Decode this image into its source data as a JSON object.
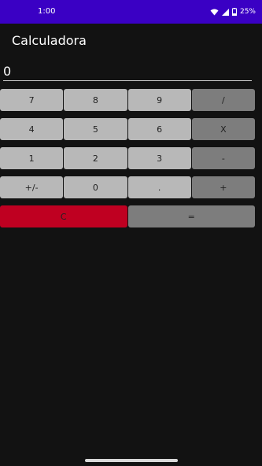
{
  "status": {
    "time": "1:00",
    "battery": "25%"
  },
  "app": {
    "title": "Calculadora"
  },
  "display": {
    "value": "0"
  },
  "keys": {
    "seven": "7",
    "eight": "8",
    "nine": "9",
    "divide": "/",
    "four": "4",
    "five": "5",
    "six": "6",
    "multiply": "X",
    "one": "1",
    "two": "2",
    "three": "3",
    "minus": "-",
    "plusminus": "+/-",
    "zero": "0",
    "dot": ".",
    "plus": "+",
    "clear": "C",
    "equals": "="
  },
  "colors": {
    "status_bar": "#3a00c4",
    "background": "#121212",
    "number_key": "#b8b8b8",
    "operator_key": "#7d7d7d",
    "clear_key": "#bf0021"
  },
  "icons": [
    "wifi-icon",
    "signal-icon",
    "battery-icon"
  ]
}
